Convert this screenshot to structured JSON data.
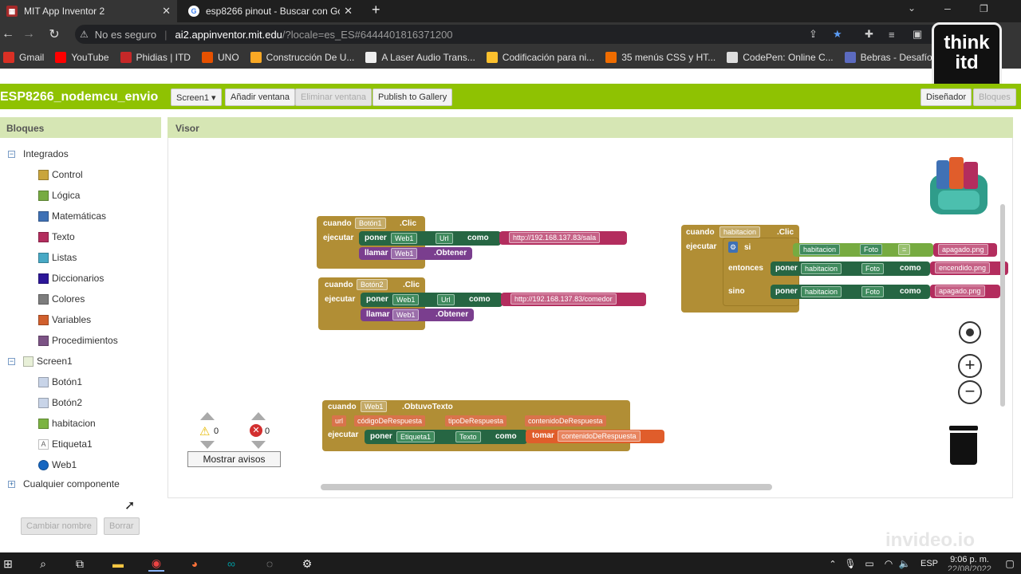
{
  "browser": {
    "tabs": [
      {
        "title": "MIT App Inventor 2",
        "favicon_color": "#a52a2a"
      },
      {
        "title": "esp8266 pinout - Buscar con Goo",
        "favicon_color": "#ffffff"
      }
    ],
    "security_label": "No es seguro",
    "url_host": "ai2.appinventor.mit.edu",
    "url_rest": "/?locale=es_ES#6444401816371200",
    "bookmarks": [
      {
        "label": "Gmail",
        "color": "#d93025"
      },
      {
        "label": "YouTube",
        "color": "#ff0000"
      },
      {
        "label": "Phidias | ITD",
        "color": "#c62828"
      },
      {
        "label": "UNO",
        "color": "#e65100"
      },
      {
        "label": "Construcción De U...",
        "color": "#f9a825"
      },
      {
        "label": "A Laser Audio Trans...",
        "color": "#eeeeee"
      },
      {
        "label": "Codificación para ni...",
        "color": "#fbc02d"
      },
      {
        "label": "35 menús CSS y HT...",
        "color": "#ef6c00"
      },
      {
        "label": "CodePen: Online C...",
        "color": "#dddddd"
      },
      {
        "label": "Bebras - Desafío Int...",
        "color": "#5c6bc0"
      }
    ],
    "logo_text_1": "think",
    "logo_text_2": "itd"
  },
  "app": {
    "project_name": "ESP8266_nodemcu_envio",
    "screen_button": "Screen1 ▾",
    "add_screen": "Añadir ventana",
    "remove_screen": "Eliminar ventana",
    "publish": "Publish to Gallery",
    "designer": "Diseñador",
    "blocks": "Bloques"
  },
  "sidebar": {
    "title": "Bloques",
    "builtin": "Integrados",
    "categories": [
      {
        "label": "Control",
        "color": "#c9a53c"
      },
      {
        "label": "Lógica",
        "color": "#77ab41"
      },
      {
        "label": "Matemáticas",
        "color": "#3f71b5"
      },
      {
        "label": "Texto",
        "color": "#b32d5e"
      },
      {
        "label": "Listas",
        "color": "#48a9c5"
      },
      {
        "label": "Diccionarios",
        "color": "#2d1799"
      },
      {
        "label": "Colores",
        "color": "#7d7d7d"
      },
      {
        "label": "Variables",
        "color": "#d05f2d"
      },
      {
        "label": "Procedimientos",
        "color": "#7c5385"
      }
    ],
    "screen": "Screen1",
    "components": [
      {
        "label": "Botón1"
      },
      {
        "label": "Botón2"
      },
      {
        "label": "habitacion"
      },
      {
        "label": "Etiqueta1"
      },
      {
        "label": "Web1"
      }
    ],
    "any_component": "Cualquier componente",
    "rename": "Cambiar nombre",
    "delete": "Borrar"
  },
  "viewer": {
    "title": "Visor",
    "warnings_count": "0",
    "errors_count": "0",
    "show_warnings": "Mostrar avisos"
  },
  "blocks": {
    "cuando": "cuando",
    "ejecutar": "ejecutar",
    "poner": "poner",
    "llamar": "llamar",
    "como": "como",
    "clic": ".Clic",
    "obtener": ".Obtener",
    "b1": {
      "comp": "Botón1",
      "web": "Web1",
      "prop": "Url",
      "url": "http://192.168.137.83/sala"
    },
    "b2": {
      "comp": "Botón2",
      "web": "Web1",
      "prop": "Url",
      "url": "http://192.168.137.83/comedor"
    },
    "hab": {
      "comp": "habitacion",
      "si": "si",
      "entonces": "entonces",
      "sino": "sino",
      "prop": "Foto",
      "eq": "=",
      "off": "apagado.png",
      "on": "encendido.png",
      "off2": "apagado.png"
    },
    "web": {
      "comp": "Web1",
      "event": ".ObtuvoTexto",
      "params": [
        "url",
        "códigoDeRespuesta",
        "tipoDeRespuesta",
        "contenidoDeRespuesta"
      ],
      "target": "Etiqueta1",
      "prop": "Texto",
      "tomar": "tomar",
      "arg": "contenidoDeRespuesta"
    }
  },
  "watermark": "invideo.io",
  "taskbar": {
    "lang": "ESP",
    "time": "9:06 p. m.",
    "date": "22/08/2022"
  }
}
